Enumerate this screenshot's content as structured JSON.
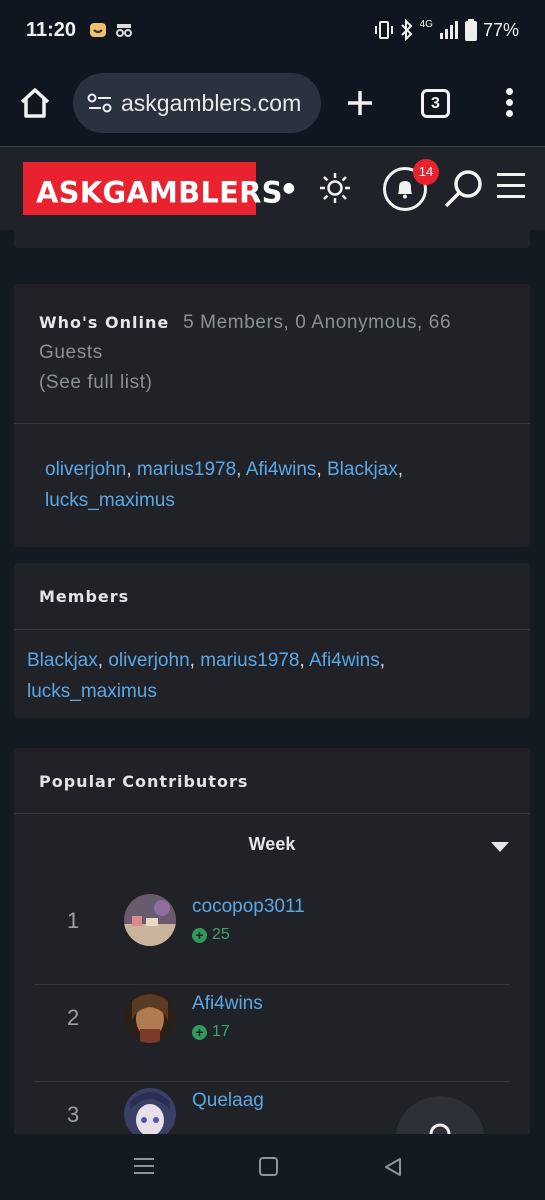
{
  "status_bar": {
    "time": "11:20",
    "battery": "77%",
    "network": "4G"
  },
  "browser": {
    "url": "askgamblers.com",
    "tab_count": "3"
  },
  "header": {
    "logo_text": "ASKGAMBLERS",
    "notification_count": "14",
    "accent_color": "#e8222e"
  },
  "whos_online": {
    "label": "Who's Online",
    "summary": "5 Members, 0 Anonymous, 66 Guests",
    "see_full_list": "(See full list)",
    "members": [
      "oliverjohn",
      "marius1978",
      "Afi4wins",
      "Blackjax",
      "lucks_maximus"
    ]
  },
  "members_card": {
    "label": "Members",
    "members": [
      "Blackjax",
      "oliverjohn",
      "marius1978",
      "Afi4wins",
      "lucks_maximus"
    ]
  },
  "popular": {
    "label": "Popular Contributors",
    "period": "Week",
    "rows": [
      {
        "rank": "1",
        "name": "cocopop3011",
        "rep": "25"
      },
      {
        "rank": "2",
        "name": "Afi4wins",
        "rep": "17"
      },
      {
        "rank": "3",
        "name": "Quelaag",
        "rep": ""
      }
    ]
  },
  "icons": {
    "home": "home-icon",
    "site_settings": "site-settings-icon",
    "new_tab": "plus-icon",
    "tabs": "tabs-icon",
    "menu": "more-vert-icon",
    "theme": "sun-icon",
    "notifications": "bell-icon",
    "search": "search-icon",
    "hamburger": "hamburger-icon"
  }
}
